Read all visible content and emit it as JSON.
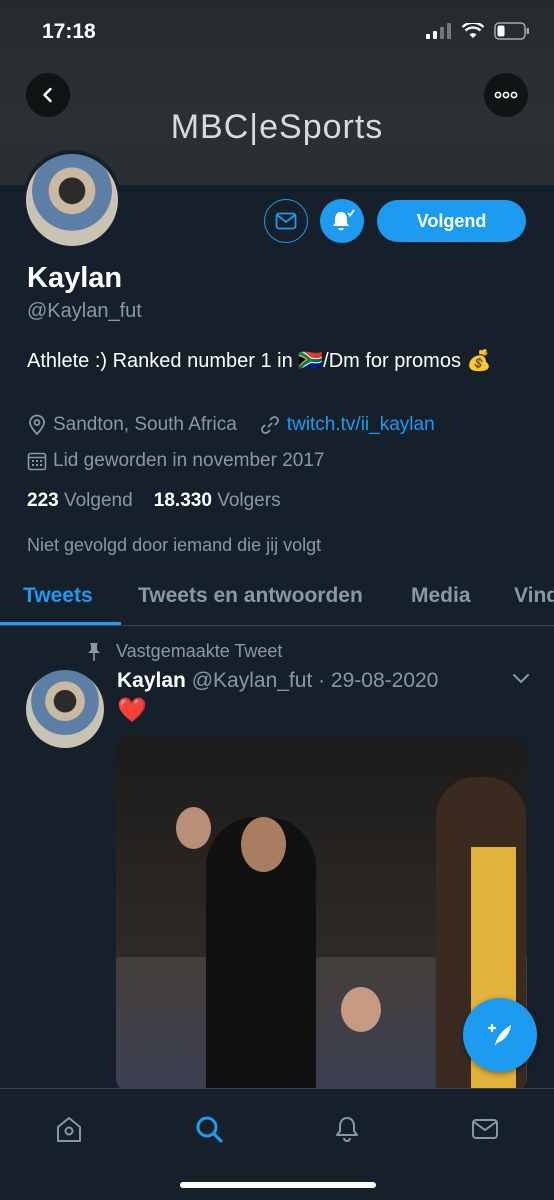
{
  "status_bar": {
    "time": "17:18"
  },
  "banner": {
    "logo_text": "MBC|eSports"
  },
  "profile": {
    "name": "Kaylan",
    "handle": "@Kaylan_fut",
    "bio": "Athlete :) Ranked number 1 in 🇿🇦/Dm for promos 💰",
    "location": "Sandton, South Africa",
    "link": "twitch.tv/ii_kaylan",
    "joined": "Lid geworden in november 2017",
    "following_count": "223",
    "following_label": "Volgend",
    "followers_count": "18.330",
    "followers_label": "Volgers",
    "not_followed": "Niet gevolgd door iemand die jij volgt",
    "follow_button": "Volgend"
  },
  "tabs": [
    {
      "label": "Tweets",
      "active": true
    },
    {
      "label": "Tweets en antwoorden",
      "active": false
    },
    {
      "label": "Media",
      "active": false
    },
    {
      "label": "Vind",
      "active": false
    }
  ],
  "tweet": {
    "pinned_label": "Vastgemaakte Tweet",
    "author": "Kaylan",
    "meta": "@Kaylan_fut · 29-08-2020",
    "text": "❤️"
  },
  "colors": {
    "accent": "#1d9bf0",
    "background": "#15202b",
    "muted": "#8899a6"
  },
  "icons": [
    "back-icon",
    "more-icon",
    "mail-icon",
    "bell-icon",
    "location-icon",
    "link-icon",
    "calendar-icon",
    "pin-icon",
    "chevron-down-icon",
    "compose-icon",
    "home-icon",
    "search-icon",
    "notifications-icon",
    "messages-icon"
  ]
}
